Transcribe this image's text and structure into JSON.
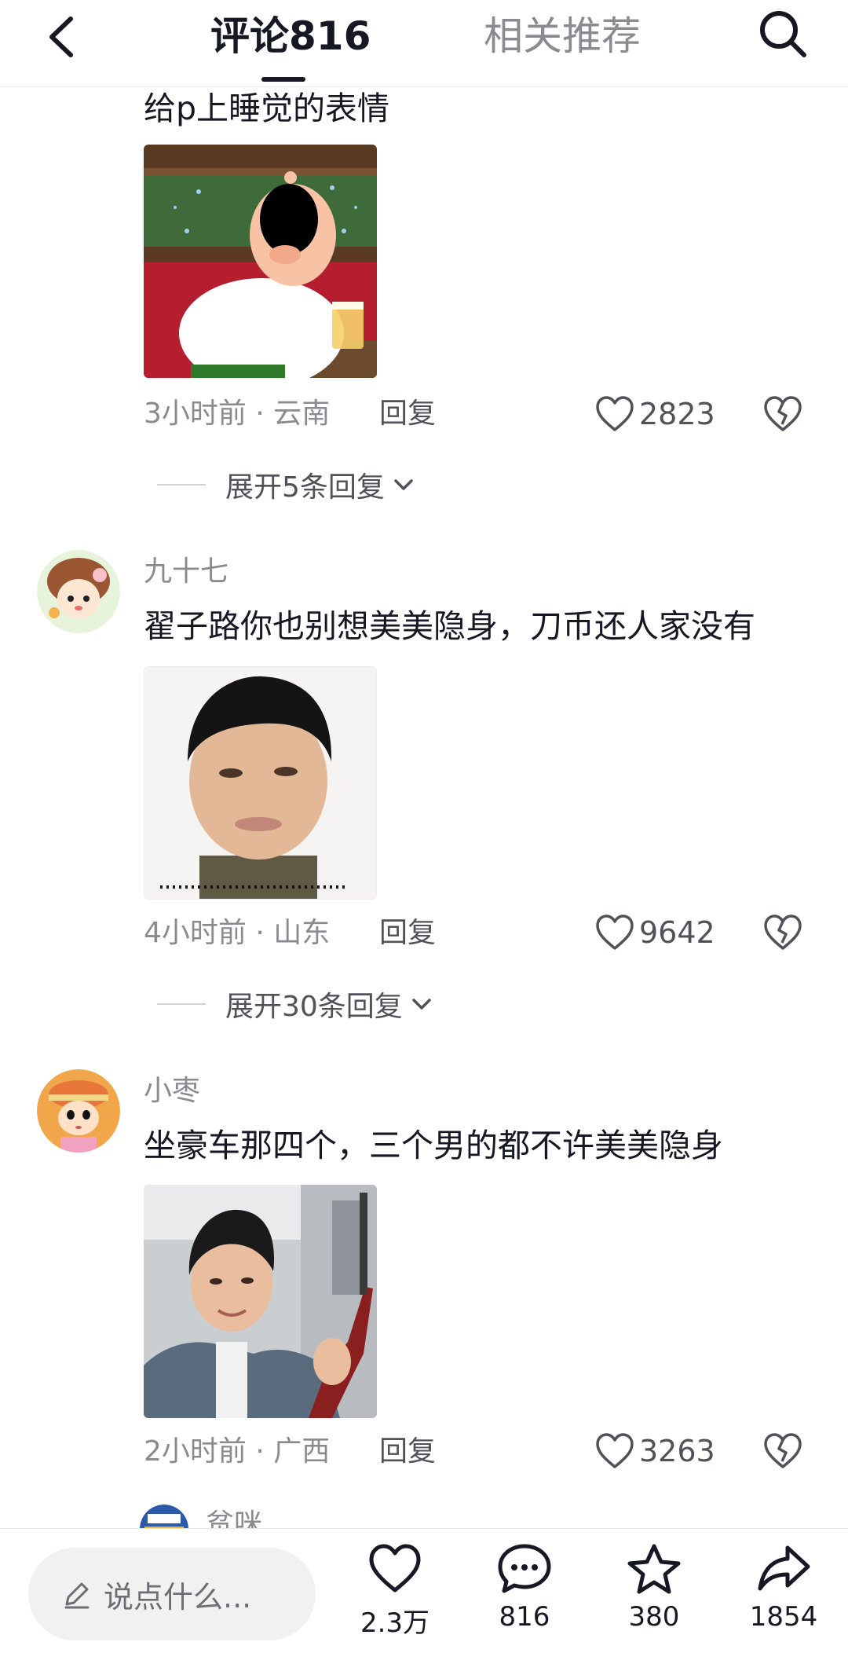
{
  "header": {
    "tabs": [
      {
        "label": "评论816",
        "active": true
      },
      {
        "label": "相关推荐",
        "active": false
      }
    ],
    "back_icon": "chevron-left-icon",
    "search_icon": "search-icon"
  },
  "comments": [
    {
      "username": "",
      "text": "给p上睡觉的表情",
      "image": "cartoon-sleeping-character-sticker",
      "time": "3小时前",
      "location": "云南",
      "reply_label": "回复",
      "likes": "2823",
      "expand_label": "展开5条回复"
    },
    {
      "username": "九十七",
      "text": "翟子路你也别想美美隐身，刀币还人家没有",
      "image": "man-face-photo",
      "time": "4小时前",
      "location": "山东",
      "reply_label": "回复",
      "likes": "9642",
      "expand_label": "展开30条回复"
    },
    {
      "username": "小枣",
      "text": "坐豪车那四个，三个男的都不许美美隐身",
      "image": "man-holding-rifle-photo",
      "time": "2小时前",
      "location": "广西",
      "reply_label": "回复",
      "likes": "3263"
    }
  ],
  "partial_next": {
    "username": "贫咪"
  },
  "bottom_bar": {
    "input_placeholder": "说点什么...",
    "actions": [
      {
        "icon": "heart-icon",
        "count": "2.3万"
      },
      {
        "icon": "comment-bubble-icon",
        "count": "816"
      },
      {
        "icon": "star-icon",
        "count": "380"
      },
      {
        "icon": "share-arrow-icon",
        "count": "1854"
      }
    ]
  },
  "colors": {
    "primary_text": "#161823",
    "secondary_text": "#8a8b91",
    "divider": "#ececec"
  }
}
